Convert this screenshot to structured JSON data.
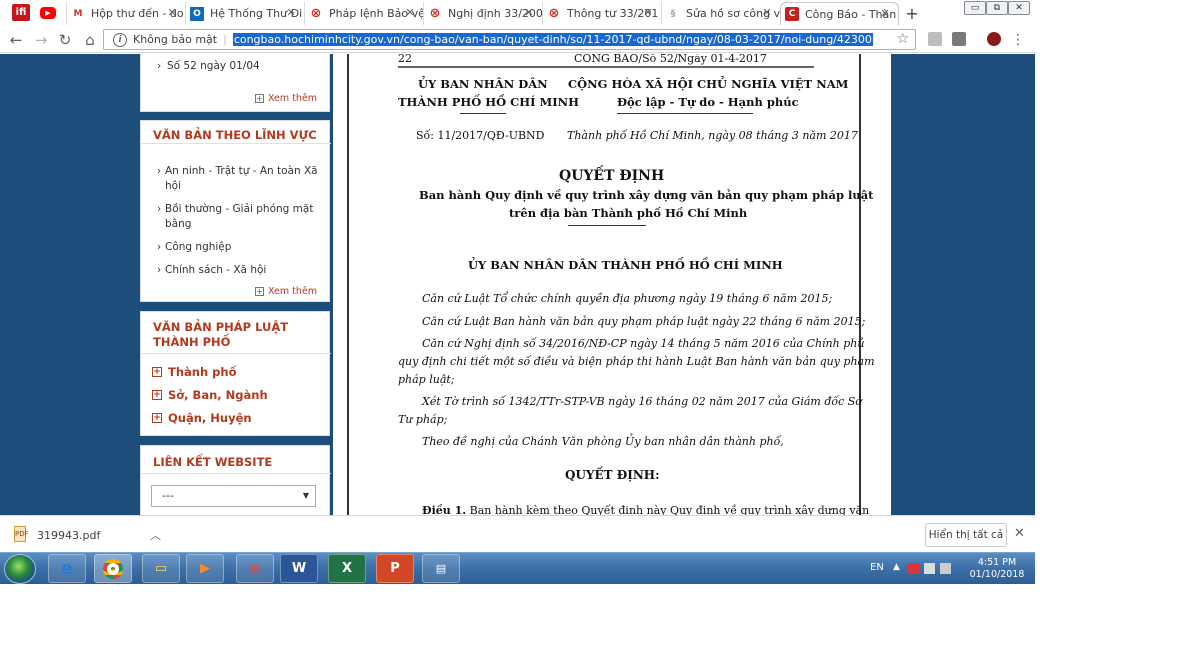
{
  "browser": {
    "tabs": [
      {
        "label": "Hộp thư đến - do",
        "icon": "M",
        "color": "#d93025"
      },
      {
        "label": "Hệ Thống Thư Đi",
        "icon": "O",
        "color": "#0f6cbd"
      },
      {
        "label": "Pháp lệnh Bảo vệ",
        "icon": "⊗",
        "color": "#d93025"
      },
      {
        "label": "Nghị định 33/200",
        "icon": "⊗",
        "color": "#d93025"
      },
      {
        "label": "Thông tư 33/201",
        "icon": "⊗",
        "color": "#d93025"
      },
      {
        "label": "Sửa hồ sơ công v",
        "icon": "§",
        "color": "#9aa0a6"
      },
      {
        "label": "Công Báo - Thàn",
        "icon": "C",
        "color": "#c5221f"
      }
    ],
    "new_tab": "+",
    "window_controls": {
      "minimize": "▭",
      "maximize": "⧉",
      "close": "✕"
    },
    "nav": {
      "back": "←",
      "forward": "→",
      "reload": "↻",
      "home": "⌂"
    },
    "omnibox": {
      "security_label": "Không bảo mật",
      "url": "congbao.hochiminhcity.gov.vn/cong-bao/van-ban/quyet-dinh/so/11-2017-qd-ubnd/ngay/08-03-2017/noi-dung/42300"
    }
  },
  "sidebar": {
    "top_item": "Số 52 ngày 01/04",
    "more_label_1": "Xem thêm",
    "field_box": {
      "title": "VĂN BẢN THEO LĨNH VỰC",
      "items": [
        "An ninh - Trật tự - An toàn Xã hội",
        "Bồi thường - Giải phóng mặt bằng",
        "Công nghiệp",
        "Chính sách - Xã hội"
      ],
      "more_label": "Xem thêm"
    },
    "law_box": {
      "title_line1": "VĂN BẢN PHÁP LUẬT",
      "title_line2": "THÀNH PHỐ",
      "categories": [
        "Thành phố",
        "Sở, Ban, Ngành",
        "Quận, Huyện"
      ]
    },
    "links_box": {
      "title": "LIÊN KẾT WEBSITE",
      "selected": "---"
    }
  },
  "document": {
    "page_number": "22",
    "gazette": "CÔNG BÁO/Số 52/Ngày 01-4-2017",
    "issuer_line1": "ỦY BAN NHÂN DÂN",
    "issuer_line2": "THÀNH PHỐ HỒ CHÍ MINH",
    "nation_line1": "CỘNG HÒA XÃ HỘI CHỦ NGHĨA VIỆT NAM",
    "nation_line2": "Độc lập - Tự do - Hạnh phúc",
    "number": "Số: 11/2017/QĐ-UBND",
    "place_date": "Thành phố Hồ Chí Minh, ngày 08 tháng 3 năm 2017",
    "title": "QUYẾT ĐỊNH",
    "subtitle_line1": "Ban hành Quy định về quy trình xây dựng văn bản quy phạm pháp luật",
    "subtitle_line2": "trên địa bàn Thành phố Hồ Chí Minh",
    "authority": "ỦY BAN NHÂN DÂN THÀNH PHỐ HỒ CHÍ MINH",
    "basis_1": "Căn cứ Luật Tổ chức chính quyền địa phương ngày 19 tháng 6 năm 2015;",
    "basis_2": "Căn cứ Luật Ban hành văn bản quy phạm pháp luật ngày 22 tháng 6 năm 2015;",
    "basis_3_line1": "Căn cứ Nghị định số 34/2016/NĐ-CP ngày 14 tháng 5 năm 2016 của Chính phủ",
    "basis_3_line2": "quy định chi tiết một số điều và biện pháp thi hành Luật Ban hành văn bản quy phạm",
    "basis_3_line3": "pháp luật;",
    "basis_4_line1": "Xét Tờ trình số 1342/TTr-STP-VB ngày 16 tháng 02 năm 2017 của Giám đốc Sở",
    "basis_4_line2": "Tư pháp;",
    "basis_5": "Theo đề nghị của Chánh Văn phòng Ủy ban nhân dân thành phố,",
    "decides": "QUYẾT ĐỊNH:",
    "article_1_label": "Điều 1.",
    "article_1_text": "Ban hành kèm theo Quyết định này Quy định về quy trình xây dựng văn"
  },
  "download_bar": {
    "file_name": "319943.pdf",
    "show_all": "Hiển thị tất cả",
    "close": "✕"
  },
  "taskbar": {
    "language": "EN",
    "time": "4:51 PM",
    "date": "01/10/2018"
  }
}
